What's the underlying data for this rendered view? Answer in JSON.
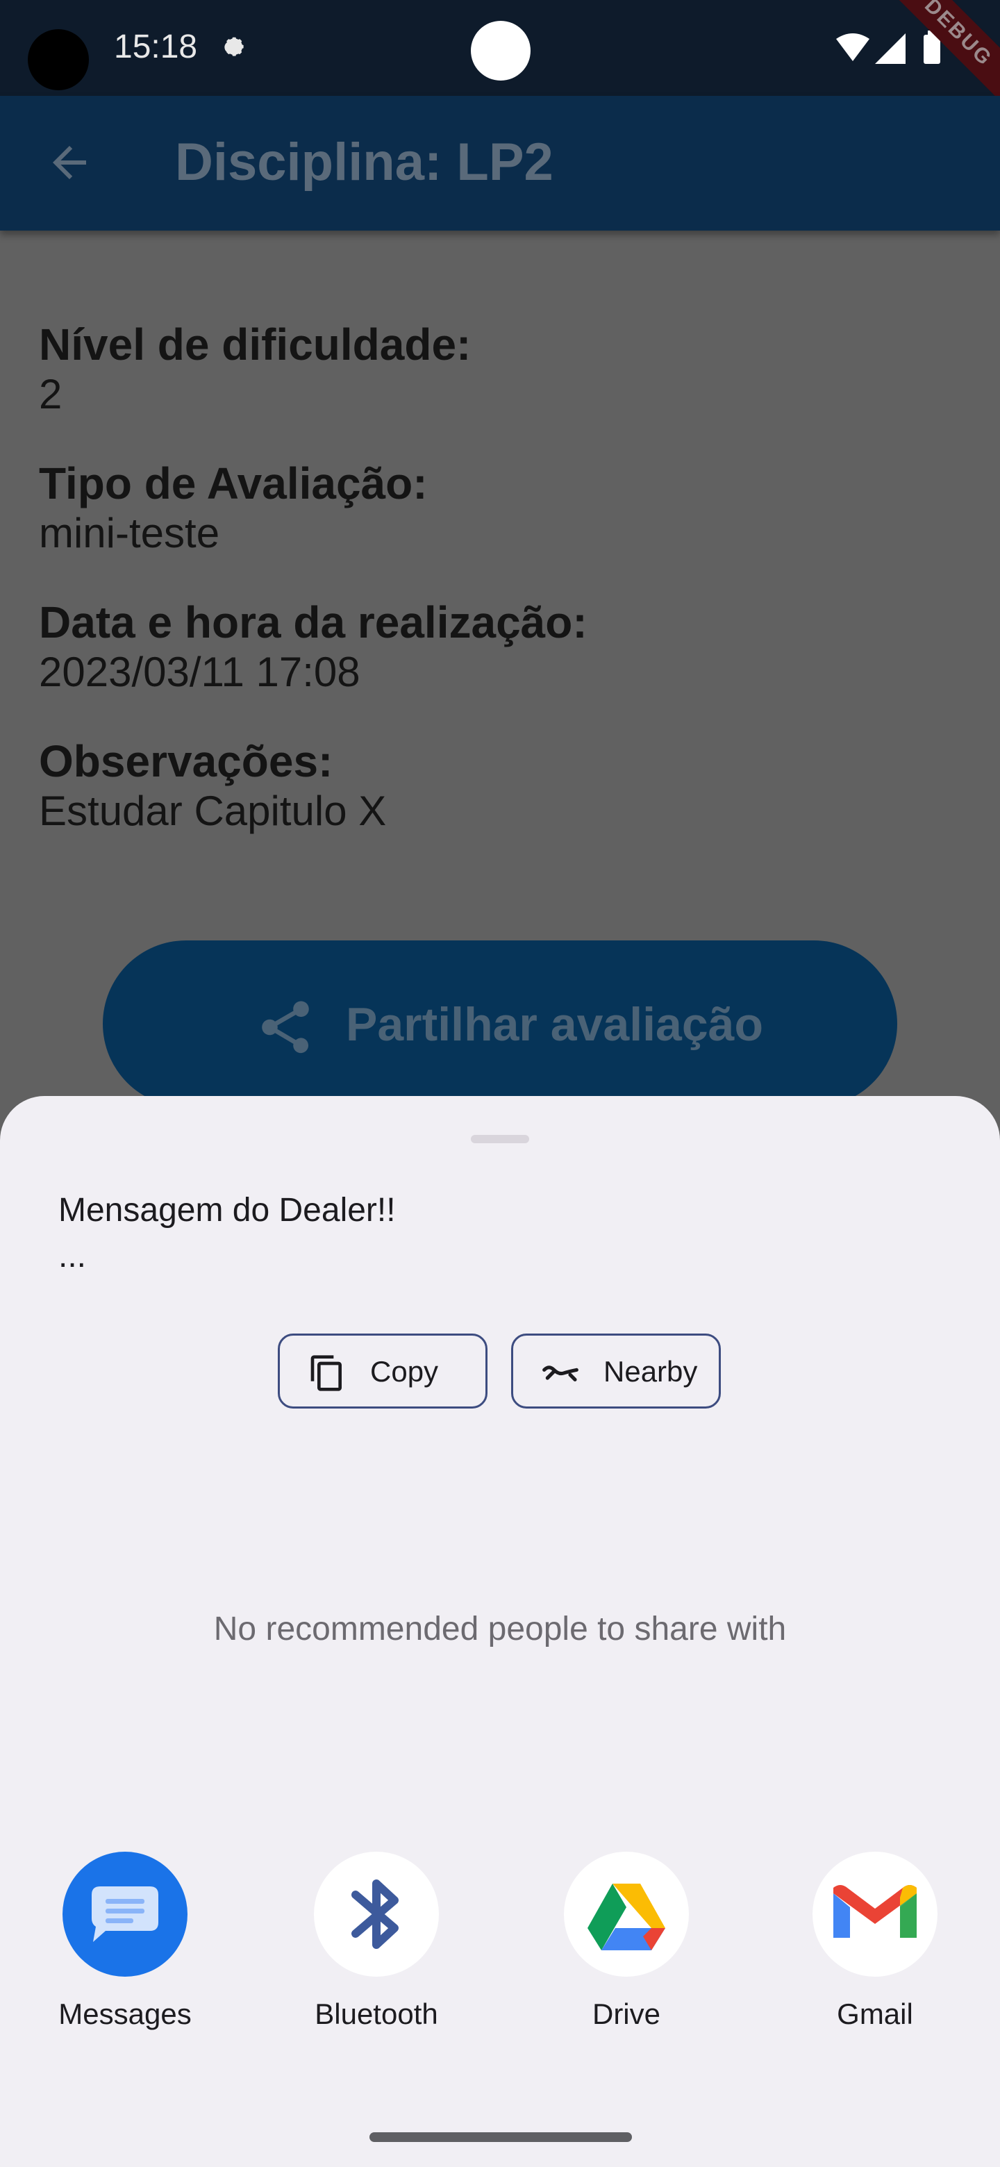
{
  "status_bar": {
    "time": "15:18",
    "debug_banner": "DEBUG"
  },
  "app_bar": {
    "title": "Disciplina: LP2"
  },
  "details": {
    "difficulty_label": "Nível de dificuldade:",
    "difficulty_value": "2",
    "type_label": "Tipo de Avaliação:",
    "type_value": "mini-teste",
    "datetime_label": "Data e hora da realização:",
    "datetime_value": "2023/03/11 17:08",
    "notes_label": "Observações:",
    "notes_value": "Estudar Capitulo X"
  },
  "share_button": {
    "label": "Partilhar avaliação"
  },
  "share_sheet": {
    "text": "Mensagem do Dealer!!\n...",
    "copy_label": "Copy",
    "nearby_label": "Nearby",
    "empty_message": "No recommended people to share with",
    "targets": [
      {
        "label": "Messages",
        "icon": "messages-icon"
      },
      {
        "label": "Bluetooth",
        "icon": "bluetooth-icon"
      },
      {
        "label": "Drive",
        "icon": "drive-icon"
      },
      {
        "label": "Gmail",
        "icon": "gmail-icon"
      }
    ]
  },
  "colors": {
    "scrim_background": "#616161",
    "app_bar": "#0b2c4b",
    "primary_button": "#063458",
    "sheet_background": "#f1eff4",
    "chip_outline": "#3d4c80",
    "messages_blue": "#1a73e8"
  }
}
